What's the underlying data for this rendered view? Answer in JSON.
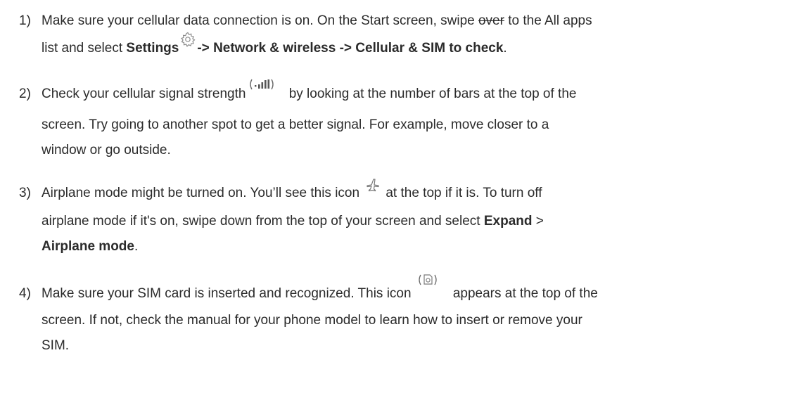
{
  "steps": [
    {
      "number": "1)",
      "l1_a": "Make sure your cellular data connection is on. On the Start screen, swipe ",
      "l1_strike": "over",
      "l1_b": " to the All apps",
      "l2_a": "list and select ",
      "l2_settings": "Settings",
      "l2_arrow1": "-> ",
      "l2_network": "Network & wireless",
      "l2_arrow2": " -> ",
      "l2_cellular": "Cellular & SIM to check",
      "l2_end": "."
    },
    {
      "number": "2)",
      "l1_a": "Check your cellular signal strength",
      "l1_b": " by looking at the number of bars at the top of the",
      "l2": "screen. Try going to another spot to get a better signal. For example, move closer to a",
      "l3": "window or go outside."
    },
    {
      "number": "3)",
      "l1_a": "Airplane mode might be turned on. You’ll see this icon",
      "l1_b": " at the top if it is. To turn off",
      "l2_a": "airplane mode if it's on, swipe down from the top of your screen and select ",
      "l2_expand": "Expand",
      "l2_b": " >",
      "l3_airplane": "Airplane mode",
      "l3_end": "."
    },
    {
      "number": "4)",
      "l1_a": "Make sure your SIM card is inserted and recognized. This icon",
      "l1_b": " appears at the top of the",
      "l2": "screen. If not, check the manual for your phone model to learn how to insert or remove your",
      "l3": "SIM."
    }
  ],
  "icons": {
    "settings": "gear-icon",
    "signal": "signal-strength-icon",
    "airplane": "airplane-icon",
    "sim": "sim-card-icon"
  }
}
